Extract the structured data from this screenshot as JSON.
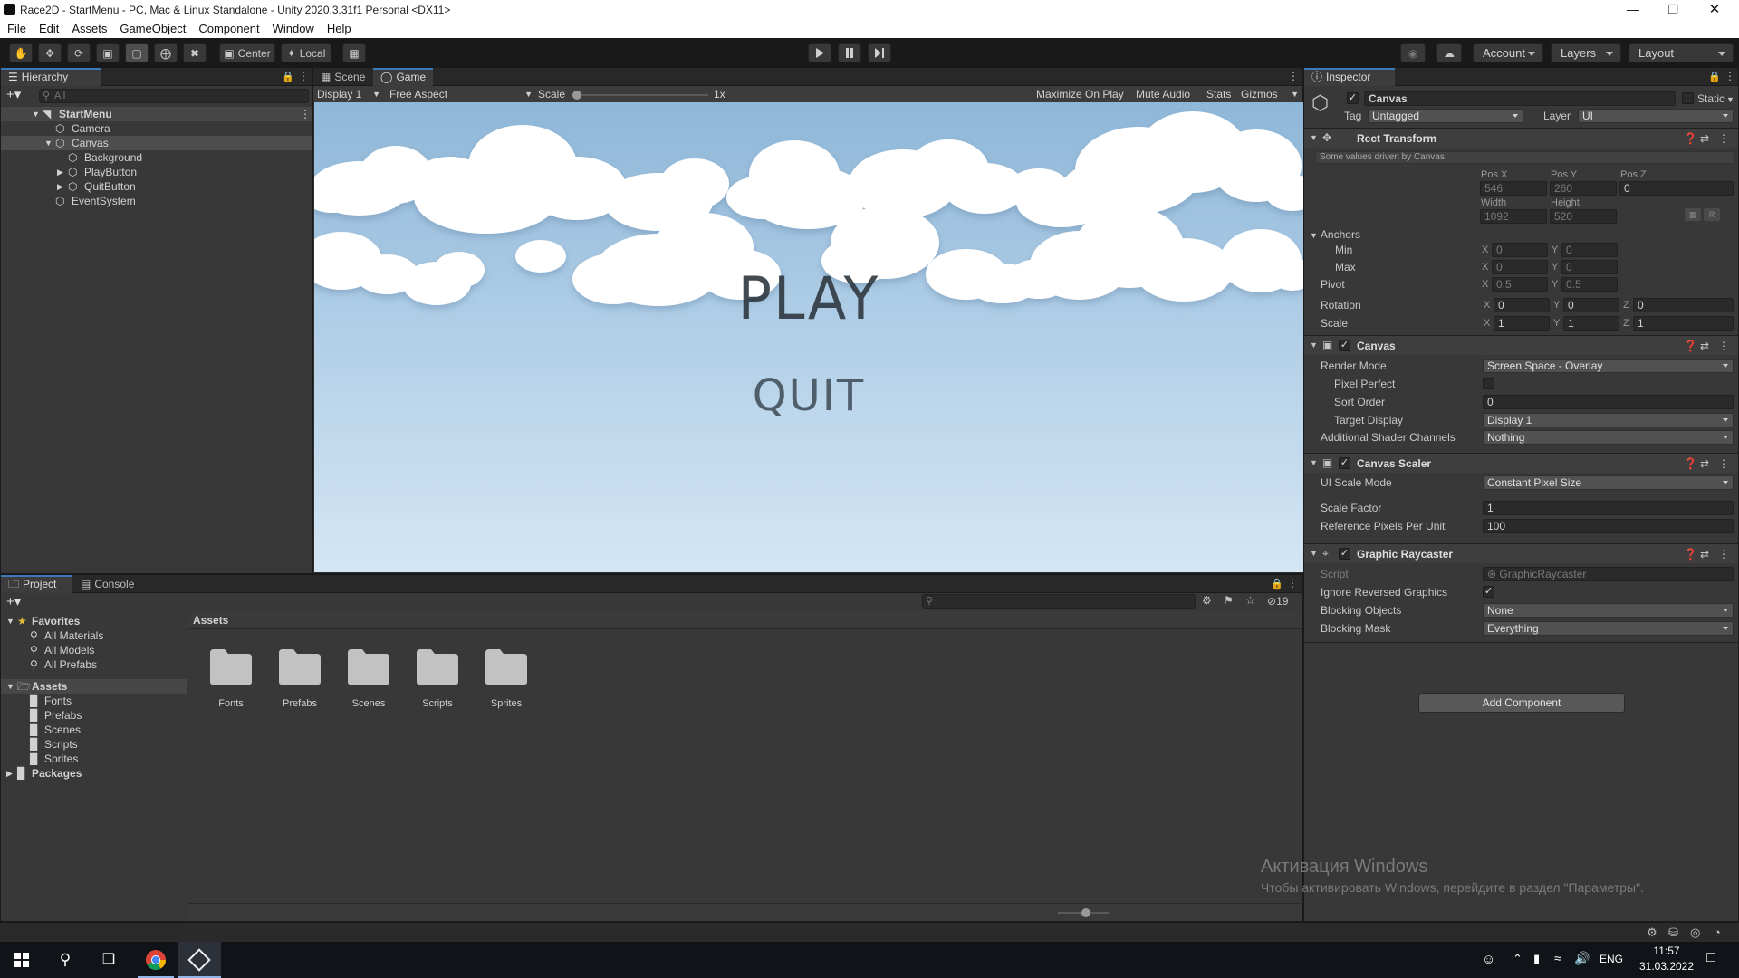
{
  "window": {
    "title": "Race2D - StartMenu - PC, Mac & Linux Standalone - Unity 2020.3.31f1 Personal <DX11>"
  },
  "menu": [
    "File",
    "Edit",
    "Assets",
    "GameObject",
    "Component",
    "Window",
    "Help"
  ],
  "toolbar": {
    "pivot_label": "Center",
    "space_label": "Local",
    "account_label": "Account",
    "layers_label": "Layers",
    "layout_label": "Layout"
  },
  "hierarchy": {
    "tab_label": "Hierarchy",
    "search_placeholder": "All",
    "scene_name": "StartMenu",
    "items": [
      "Camera",
      "Canvas",
      "Background",
      "PlayButton",
      "QuitButton",
      "EventSystem"
    ]
  },
  "game_view": {
    "tabs": [
      "Scene",
      "Game"
    ],
    "display": "Display 1",
    "aspect": "Free Aspect",
    "scale_label": "Scale",
    "scale_value": "1x",
    "scale_fraction": 0.0,
    "toggles": [
      "Maximize On Play",
      "Mute Audio",
      "Stats",
      "Gizmos"
    ],
    "play_text": "PLAY",
    "quit_text": "QUIT"
  },
  "project": {
    "tabs": [
      "Project",
      "Console"
    ],
    "favorites_label": "Favorites",
    "favorites": [
      "All Materials",
      "All Models",
      "All Prefabs"
    ],
    "assets_label": "Assets",
    "asset_folders": [
      "Fonts",
      "Prefabs",
      "Scenes",
      "Scripts",
      "Sprites"
    ],
    "packages_label": "Packages",
    "breadcrumb": "Assets",
    "hidden_count": "19",
    "folders": [
      "Fonts",
      "Prefabs",
      "Scenes",
      "Scripts",
      "Sprites"
    ]
  },
  "inspector": {
    "tab_label": "Inspector",
    "object_name": "Canvas",
    "static_label": "Static",
    "tag_label": "Tag",
    "tag_value": "Untagged",
    "layer_label": "Layer",
    "layer_value": "UI",
    "rect": {
      "title": "Rect Transform",
      "note": "Some values driven by Canvas.",
      "pos_x_label": "Pos X",
      "pos_y_label": "Pos Y",
      "pos_z_label": "Pos Z",
      "pos_x": "546",
      "pos_y": "260",
      "pos_z": "0",
      "width_label": "Width",
      "height_label": "Height",
      "width": "1092",
      "height": "520",
      "anchors_label": "Anchors",
      "min_label": "Min",
      "min_x": "0",
      "min_y": "0",
      "max_label": "Max",
      "max_x": "0",
      "max_y": "0",
      "pivot_label": "Pivot",
      "pivot_x": "0.5",
      "pivot_y": "0.5",
      "rotation_label": "Rotation",
      "rot_x": "0",
      "rot_y": "0",
      "rot_z": "0",
      "scale_label": "Scale",
      "scale_x": "1",
      "scale_y": "1",
      "scale_z": "1",
      "r_button": "R"
    },
    "canvas": {
      "title": "Canvas",
      "render_mode_label": "Render Mode",
      "render_mode": "Screen Space - Overlay",
      "pixel_perfect_label": "Pixel Perfect",
      "sort_order_label": "Sort Order",
      "sort_order": "0",
      "target_display_label": "Target Display",
      "target_display": "Display 1",
      "shader_channels_label": "Additional Shader Channels",
      "shader_channels": "Nothing"
    },
    "scaler": {
      "title": "Canvas Scaler",
      "scale_mode_label": "UI Scale Mode",
      "scale_mode": "Constant Pixel Size",
      "scale_factor_label": "Scale Factor",
      "scale_factor": "1",
      "ref_ppu_label": "Reference Pixels Per Unit",
      "ref_ppu": "100"
    },
    "raycaster": {
      "title": "Graphic Raycaster",
      "script_label": "Script",
      "script_value": "GraphicRaycaster",
      "ignore_reversed_label": "Ignore Reversed Graphics",
      "blocking_objects_label": "Blocking Objects",
      "blocking_objects": "None",
      "blocking_mask_label": "Blocking Mask",
      "blocking_mask": "Everything"
    },
    "add_component": "Add Component"
  },
  "watermark": {
    "line1": "Активация Windows",
    "line2": "Чтобы активировать Windows, перейдите в раздел \"Параметры\"."
  },
  "taskbar": {
    "language": "ENG",
    "time": "11:57",
    "date": "31.03.2022"
  }
}
